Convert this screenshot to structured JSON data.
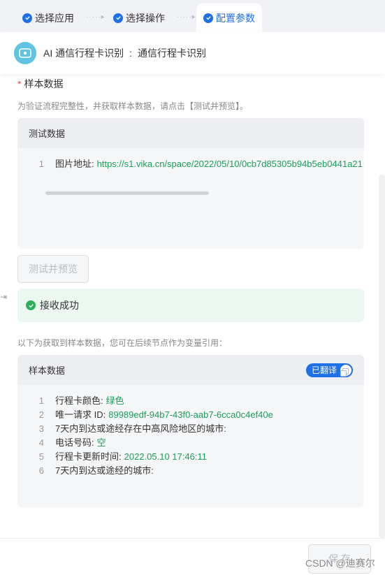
{
  "steps": [
    {
      "label": "选择应用"
    },
    {
      "label": "选择操作"
    },
    {
      "label": "配置参数"
    }
  ],
  "step_arrow": "·····▸",
  "header": {
    "app_name": "AI 通信行程卡识别",
    "separator": ":",
    "action_name": "通信行程卡识别"
  },
  "sample": {
    "required_label": "样本数据",
    "required_mark": "*",
    "hint": "为验证流程完整性，并获取样本数据，请点击【测试并预览】。",
    "test_card_title": "测试数据",
    "test_lines": [
      {
        "ln": "1",
        "key": "图片地址:",
        "value": "https://s1.vika.cn/space/2022/05/10/0cb7d85305b94b5eb0441a21"
      }
    ],
    "test_button": "测试并预览",
    "success_text": "接收成功",
    "hint2": "以下为获取到样本数据，您可在后续节点作为变量引用：",
    "result_card_title": "样本数据",
    "translate_toggle": "已翻译",
    "result_lines": [
      {
        "ln": "1",
        "key": "行程卡颜色:",
        "value": "绿色"
      },
      {
        "ln": "2",
        "key": "唯一请求 ID:",
        "value": "89989edf-94b7-43f0-aab7-6cca0c4ef40e"
      },
      {
        "ln": "3",
        "key": "7天内到达或途经存在中高风险地区的城市:",
        "value": ""
      },
      {
        "ln": "4",
        "key": "电话号码:",
        "value": "空"
      },
      {
        "ln": "5",
        "key": "行程卡更新时间:",
        "value": "2022.05.10 17:46:11"
      },
      {
        "ln": "6",
        "key": "7天内到达或途经的城市:",
        "value": ""
      }
    ]
  },
  "footer": {
    "save_button": "保 存",
    "watermark": "CSDN @迪赛尔"
  },
  "colors": {
    "accent": "#1f6fe5",
    "success": "#26b05a",
    "value_green": "#1a9e5a",
    "required": "#e34d4d"
  }
}
